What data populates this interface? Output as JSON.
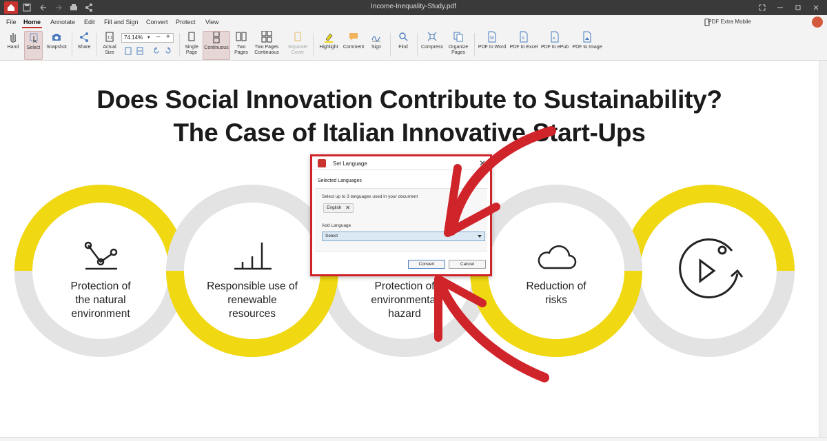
{
  "titlebar": {
    "filename": "Income-Inequality-Study.pdf"
  },
  "menu": [
    "File",
    "Home",
    "Annotate",
    "Edit",
    "Fill and Sign",
    "Convert",
    "Protect",
    "View"
  ],
  "mobile_link": "PDF Extra Mobile",
  "ribbon": {
    "hand": "Hand",
    "select": "Select",
    "snapshot": "Snapshot",
    "share": "Share",
    "actual_size_1": "Actual",
    "actual_size_2": "Size",
    "zoom": "74.14%",
    "single_page_1": "Single",
    "single_page_2": "Page",
    "continuous": "Continuous",
    "two_pages_1": "Two",
    "two_pages_2": "Pages",
    "two_pages_cont_1": "Two Pages",
    "two_pages_cont_2": "Continuous",
    "separate_cover_1": "Separate",
    "separate_cover_2": "Cover",
    "highlight": "Highlight",
    "comment": "Comment",
    "sign": "Sign",
    "find": "Find",
    "compress": "Compress",
    "organize_1": "Organize",
    "organize_2": "Pages",
    "pdf_word": "PDF to Word",
    "pdf_excel": "PDF to Excel",
    "pdf_epub": "PDF to ePub",
    "pdf_image": "PDF to Image"
  },
  "document": {
    "title_line1": "Does Social Innovation Contribute to Sustainability?",
    "title_line2": "The Case of Italian Innovative Start-Ups",
    "items": [
      {
        "l1": "Protection of",
        "l2": "the natural",
        "l3": "environment"
      },
      {
        "l1": "Responsible use of",
        "l2": "renewable",
        "l3": "resources"
      },
      {
        "l1": "Protection of",
        "l2": "environmental",
        "l3": "hazard"
      },
      {
        "l1": "Reduction of",
        "l2": "risks",
        "l3": ""
      }
    ]
  },
  "dialog": {
    "title": "Set Language",
    "section": "Selected Languages",
    "hint": "Select up to 3 languages used in your document",
    "chip": "English",
    "add_label": "Add Language",
    "select_value": "Select",
    "convert": "Convert",
    "cancel": "Cancel"
  },
  "colors": {
    "accent": "#c8322f",
    "ring_yellow": "#f0d812",
    "ring_gray": "#e3e3e3",
    "arrow": "#d0242b"
  }
}
